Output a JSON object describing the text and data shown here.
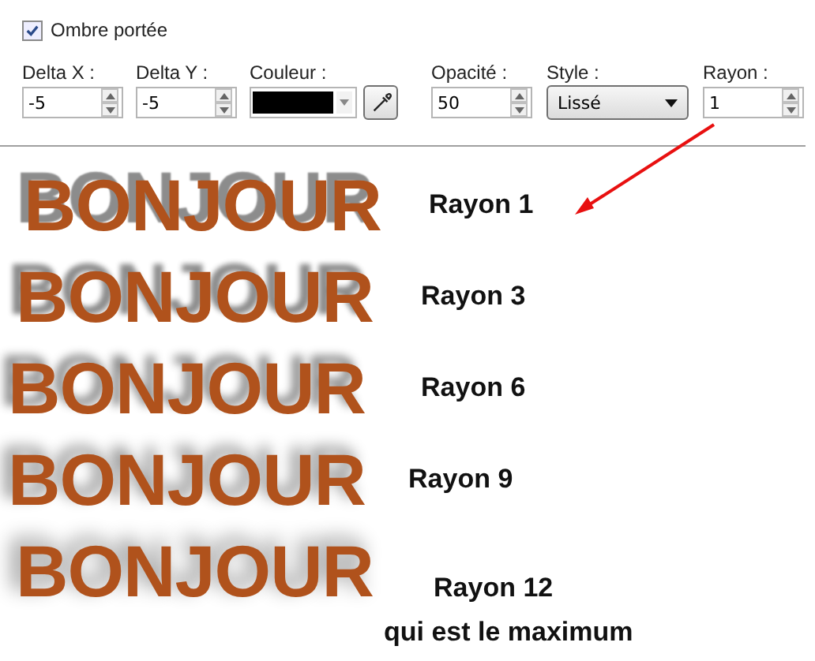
{
  "shadow_toggle": {
    "label": "Ombre portée",
    "checked": true
  },
  "fields": [
    {
      "kind": "spin",
      "label": "Delta X :",
      "value": "-5"
    },
    {
      "kind": "spin",
      "label": "Delta Y :",
      "value": "-5"
    },
    {
      "kind": "color",
      "label": "Couleur :",
      "color": "#000000"
    },
    {
      "kind": "spin",
      "label": "Opacité :",
      "value": "50"
    },
    {
      "kind": "select",
      "label": "Style :",
      "value": "Lissé"
    },
    {
      "kind": "spin",
      "label": "Rayon :",
      "value": "1"
    }
  ],
  "samples": [
    {
      "text": "BONJOUR",
      "caption": "Rayon 1"
    },
    {
      "text": "BONJOUR",
      "caption": "Rayon 3"
    },
    {
      "text": "BONJOUR",
      "caption": "Rayon 6"
    },
    {
      "text": "BONJOUR",
      "caption": "Rayon 9"
    },
    {
      "text": "BONJOUR",
      "caption": "Rayon 12",
      "note": "qui est le maximum"
    }
  ]
}
